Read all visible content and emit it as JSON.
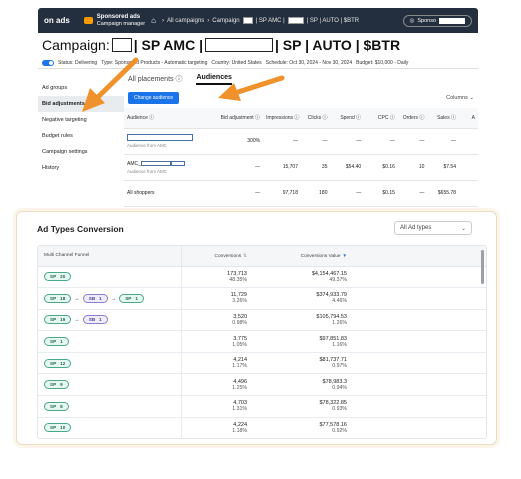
{
  "topbar": {
    "logo": "on ads",
    "app_line1": "Sponsored ads",
    "app_line2": "Campaign manager",
    "all_campaigns": "All campaigns",
    "campaign_prefix": "Campaign",
    "crumb_suffix_1": "| SP AMC |",
    "crumb_suffix_2": "| SP | AUTO | $BTR",
    "account_label": "Sponso"
  },
  "campaign": {
    "title_prefix": "Campaign:",
    "part_1": "| SP AMC |",
    "part_2": "| SP | AUTO | $BTR"
  },
  "status_row": {
    "status": "Status: Delivering",
    "type": "Type: Sponsored Products - Automatic targeting",
    "country": "Country: United States",
    "schedule": "Schedule: Oct 30, 2024 - Nov 30, 2024",
    "budget": "Budget: $10,000 - Daily"
  },
  "sidenav": {
    "items": [
      {
        "label": "Ad groups"
      },
      {
        "label": "Bid adjustments"
      },
      {
        "label": "Negative targeting"
      },
      {
        "label": "Budget rules"
      },
      {
        "label": "Campaign settings"
      },
      {
        "label": "History"
      }
    ]
  },
  "tabs": [
    {
      "label": "All placements"
    },
    {
      "label": "Audiences"
    }
  ],
  "actions": {
    "change_audience": "Change audience",
    "columns": "Columns"
  },
  "audience_table": {
    "headers": [
      "Audience",
      "Bid adjustment",
      "Impressions",
      "Clicks",
      "Spend",
      "CPC",
      "Orders",
      "Sales",
      "A"
    ],
    "rows": [
      {
        "name": "",
        "sub": "Audience from AMC",
        "bid": "300%",
        "impressions": "—",
        "clicks": "—",
        "spend": "—",
        "cpc": "—",
        "orders": "—",
        "sales": "—"
      },
      {
        "name": "AMC_",
        "sub": "Audience from AMC",
        "bid": "—",
        "impressions": "15,707",
        "clicks": "35",
        "spend": "$54.40",
        "cpc": "$0.16",
        "orders": "10",
        "sales": "$7.54"
      },
      {
        "name": "All shoppers",
        "sub": "",
        "bid": "—",
        "impressions": "97,718",
        "clicks": "180",
        "spend": "—",
        "cpc": "$0.15",
        "orders": "—",
        "sales": "$655.78"
      }
    ]
  },
  "conversion": {
    "title": "Ad Types Conversion",
    "select_value": "All Ad types",
    "headers": {
      "funnel": "Multi Channel Funnel",
      "conversions": "Conversions",
      "value": "Conversions Value"
    },
    "rows": [
      {
        "path": [
          {
            "t": "SP",
            "n": "20",
            "kind": "sp"
          }
        ],
        "conversions": "173,713",
        "conv_pct": "48.35%",
        "value": "$4,154,467.15",
        "value_pct": "49.37%"
      },
      {
        "path": [
          {
            "t": "SP",
            "n": "18",
            "kind": "sp"
          },
          {
            "t": "SB",
            "n": "1",
            "kind": "sb"
          },
          {
            "t": "SP",
            "n": "1",
            "kind": "sp"
          }
        ],
        "conversions": "11,729",
        "conv_pct": "3.26%",
        "value": "$374,933.79",
        "value_pct": "4.46%"
      },
      {
        "path": [
          {
            "t": "SP",
            "n": "19",
            "kind": "sp"
          },
          {
            "t": "SB",
            "n": "1",
            "kind": "sb"
          }
        ],
        "conversions": "3,520",
        "conv_pct": "0.98%",
        "value": "$105,794.53",
        "value_pct": "1.26%"
      },
      {
        "path": [
          {
            "t": "SP",
            "n": "1",
            "kind": "sp"
          }
        ],
        "conversions": "3,775",
        "conv_pct": "1.05%",
        "value": "$97,851.83",
        "value_pct": "1.16%"
      },
      {
        "path": [
          {
            "t": "SP",
            "n": "12",
            "kind": "sp"
          }
        ],
        "conversions": "4,214",
        "conv_pct": "1.17%",
        "value": "$81,737.71",
        "value_pct": "0.97%"
      },
      {
        "path": [
          {
            "t": "SP",
            "n": "9",
            "kind": "sp"
          }
        ],
        "conversions": "4,496",
        "conv_pct": "1.25%",
        "value": "$78,983.3",
        "value_pct": "0.94%"
      },
      {
        "path": [
          {
            "t": "SP",
            "n": "8",
            "kind": "sp"
          }
        ],
        "conversions": "4,703",
        "conv_pct": "1.31%",
        "value": "$78,322.85",
        "value_pct": "0.93%"
      },
      {
        "path": [
          {
            "t": "SP",
            "n": "10",
            "kind": "sp"
          }
        ],
        "conversions": "4,224",
        "conv_pct": "1.18%",
        "value": "$77,578.16",
        "value_pct": "0.92%"
      }
    ]
  },
  "colors": {
    "topbar": "#232f3e",
    "accent_orange": "#f0922b",
    "primary_blue": "#1a73e8",
    "sp_pill": "#4aa88a",
    "sb_pill": "#8a7ed0"
  }
}
